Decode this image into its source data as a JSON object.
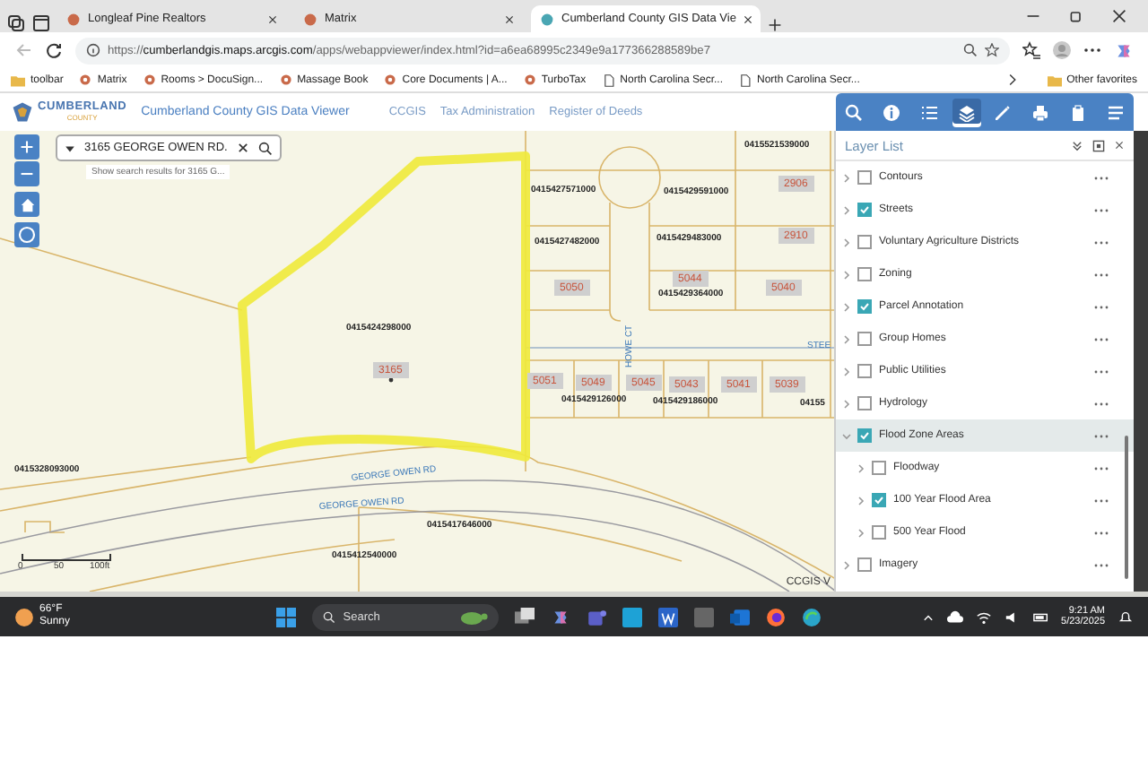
{
  "browser": {
    "tabs": [
      {
        "title": "Longleaf Pine Realtors",
        "selected": false
      },
      {
        "title": "Matrix",
        "selected": false
      },
      {
        "title": "Cumberland County GIS Data Vie",
        "selected": true
      }
    ],
    "address_bar": {
      "url": "https://**cumberlandgis.maps.arcgis.com**/apps/webappviewer/index.html?id=a6ea68995c2349e9a177366288589be7"
    },
    "bookmarks": [
      {
        "label": "toolbar",
        "kind": "folder"
      },
      {
        "label": "Matrix",
        "kind": "site"
      },
      {
        "label": "Rooms > DocuSign...",
        "kind": "site"
      },
      {
        "label": "Massage Book",
        "kind": "site"
      },
      {
        "label": "Core Documents | A...",
        "kind": "site"
      },
      {
        "label": "TurboTax",
        "kind": "site"
      },
      {
        "label": "North Carolina Secr...",
        "kind": "page"
      },
      {
        "label": "North Carolina Secr...",
        "kind": "page"
      }
    ],
    "other_favorites": "Other favorites"
  },
  "app_header": {
    "logo_name": "CUMBERLAND",
    "logo_sub": "COUNTY",
    "title": "Cumberland County GIS Data Viewer",
    "links": [
      "CCGIS",
      "Tax Administration",
      "Register of Deeds"
    ],
    "tools": [
      {
        "kind": "search",
        "selected": false
      },
      {
        "kind": "info",
        "selected": false
      },
      {
        "kind": "list",
        "selected": false
      },
      {
        "kind": "layers",
        "selected": true
      },
      {
        "kind": "measure",
        "selected": false
      },
      {
        "kind": "print",
        "selected": false
      },
      {
        "kind": "clipboard",
        "selected": false
      },
      {
        "kind": "menu",
        "selected": false
      }
    ]
  },
  "map": {
    "search": {
      "value": "3165 GEORGE OWEN RD.",
      "suggestion": "Show search results for 3165 G..."
    },
    "labels": [
      {
        "text": "0415521539000",
        "kind": "parcel"
      },
      {
        "text": "0415427571000",
        "kind": "parcel"
      },
      {
        "text": "0415429591000",
        "kind": "parcel"
      },
      {
        "text": "2906",
        "kind": "address"
      },
      {
        "text": "0415427482000",
        "kind": "parcel"
      },
      {
        "text": "0415429483000",
        "kind": "parcel"
      },
      {
        "text": "2910",
        "kind": "address"
      },
      {
        "text": "5050",
        "kind": "address"
      },
      {
        "text": "5044",
        "kind": "address"
      },
      {
        "text": "0415429364000",
        "kind": "parcel"
      },
      {
        "text": "5040",
        "kind": "address"
      },
      {
        "text": "0415424298000",
        "kind": "parcel"
      },
      {
        "text": "HOWE CT",
        "kind": "street"
      },
      {
        "text": "STEE",
        "kind": "street"
      },
      {
        "text": "3165",
        "kind": "address"
      },
      {
        "text": "5051",
        "kind": "address"
      },
      {
        "text": "5049",
        "kind": "address"
      },
      {
        "text": "5045",
        "kind": "address"
      },
      {
        "text": "5043",
        "kind": "address"
      },
      {
        "text": "5041",
        "kind": "address"
      },
      {
        "text": "5039",
        "kind": "address"
      },
      {
        "text": "0415429126000",
        "kind": "parcel"
      },
      {
        "text": "0415429186000",
        "kind": "parcel"
      },
      {
        "text": "04155",
        "kind": "parcel"
      },
      {
        "text": "0415328093000",
        "kind": "parcel"
      },
      {
        "text": "GEORGE OWEN RD",
        "kind": "street"
      },
      {
        "text": "GEORGE OWEN RD",
        "kind": "street"
      },
      {
        "text": "0415417646000",
        "kind": "parcel"
      },
      {
        "text": "0415412540000",
        "kind": "parcel"
      }
    ],
    "scale_bar": [
      "0",
      "50",
      "100ft"
    ],
    "attribution": "CCGIS V"
  },
  "layer_list": {
    "title": "Layer List",
    "layers": [
      {
        "label": "Contours",
        "checked": false,
        "selected": false,
        "expanded": false
      },
      {
        "label": "Streets",
        "checked": true,
        "selected": false,
        "expanded": false
      },
      {
        "label": "Voluntary Agriculture Districts",
        "checked": false,
        "selected": false,
        "expanded": false
      },
      {
        "label": "Zoning",
        "checked": false,
        "selected": false,
        "expanded": false
      },
      {
        "label": "Parcel Annotation",
        "checked": true,
        "selected": false,
        "expanded": false
      },
      {
        "label": "Group Homes",
        "checked": false,
        "selected": false,
        "expanded": false
      },
      {
        "label": "Public Utilities",
        "checked": false,
        "selected": false,
        "expanded": false
      },
      {
        "label": "Hydrology",
        "checked": false,
        "selected": false,
        "expanded": false
      },
      {
        "label": "Flood Zone Areas",
        "checked": true,
        "selected": true,
        "expanded": true,
        "children": [
          {
            "label": "Floodway",
            "checked": false,
            "selected": false,
            "expanded": false
          },
          {
            "label": "100 Year Flood Area",
            "checked": true,
            "selected": false,
            "expanded": false
          },
          {
            "label": "500 Year Flood",
            "checked": false,
            "selected": false,
            "expanded": false
          }
        ]
      },
      {
        "label": "Imagery",
        "checked": false,
        "selected": false,
        "expanded": false
      }
    ]
  },
  "taskbar": {
    "temperature": "66°F",
    "weather": "Sunny",
    "search_placeholder": "Search",
    "time": "9:21 AM",
    "date": "5/23/2025"
  }
}
